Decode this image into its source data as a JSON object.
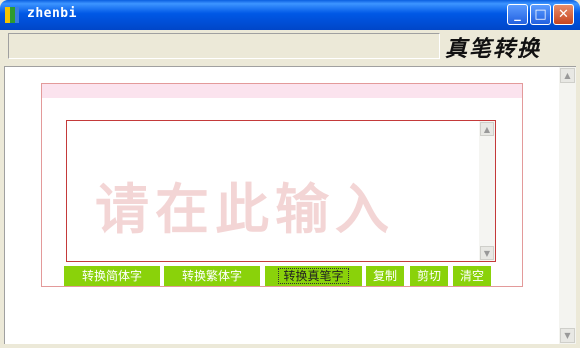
{
  "window": {
    "title": "zhenbi"
  },
  "toolbar": {
    "logo": "真笔转换"
  },
  "editor": {
    "placeholder_watermark": "请在此输入"
  },
  "buttons": [
    {
      "label": "转换简体字"
    },
    {
      "label": "转换繁体字"
    },
    {
      "label": "转换真笔字",
      "selected": true
    },
    {
      "label": "复制"
    },
    {
      "label": "剪切"
    },
    {
      "label": "清空"
    }
  ],
  "colors": {
    "button_bg": "#8AD20A",
    "frame_border": "#E39A9A",
    "textarea_border": "#C43A3A"
  }
}
